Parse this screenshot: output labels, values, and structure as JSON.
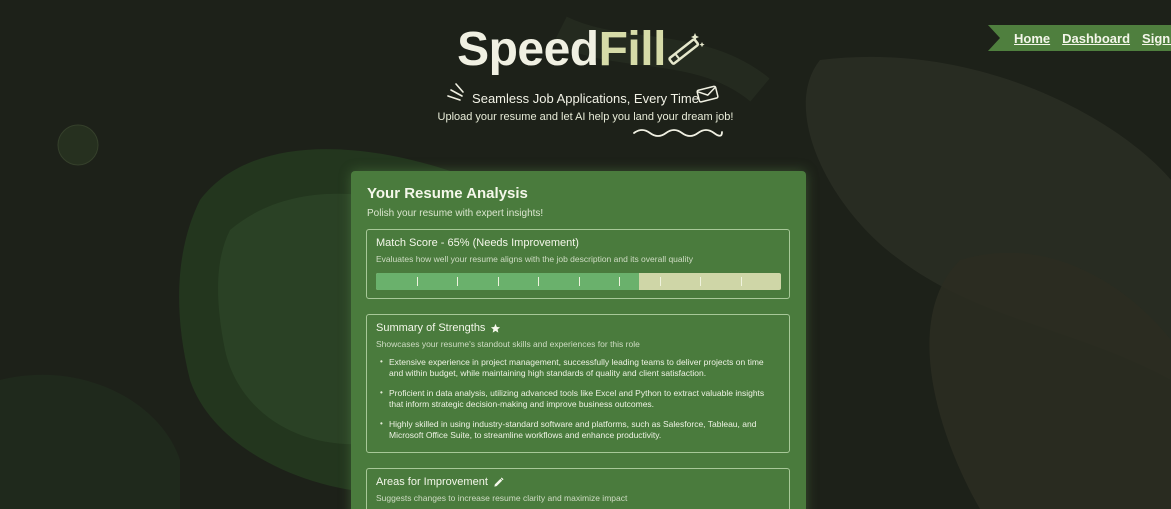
{
  "nav": {
    "home": "Home",
    "dashboard": "Dashboard",
    "signout": "Sign Out"
  },
  "header": {
    "logo_part1": "Speed",
    "logo_part2": "Fill",
    "tagline": "Seamless Job Applications, Every Time",
    "subline": "Upload your resume and let AI help you land your dream job!"
  },
  "card": {
    "title": "Your Resume Analysis",
    "subtitle": "Polish your resume with expert insights!",
    "match": {
      "title": "Match Score - 65% (Needs Improvement)",
      "description": "Evaluates how well your resume aligns with the job description and its overall quality",
      "score_percent": 65
    },
    "strengths": {
      "title": "Summary of Strengths",
      "icon": "star-icon",
      "description": "Showcases your resume's standout skills and experiences for this role",
      "items": [
        "Extensive experience in project management, successfully leading teams to deliver projects on time and within budget, while maintaining high standards of quality and client satisfaction.",
        "Proficient in data analysis, utilizing advanced tools like Excel and Python to extract valuable insights that inform strategic decision-making and improve business outcomes.",
        "Highly skilled in using industry-standard software and platforms, such as Salesforce, Tableau, and Microsoft Office Suite, to streamline workflows and enhance productivity."
      ]
    },
    "improvement": {
      "title": "Areas for Improvement",
      "icon": "pencil-icon",
      "description": "Suggests changes to increase resume clarity and maximize impact"
    }
  },
  "colors": {
    "background": "#1d2119",
    "card": "#4a7b3d",
    "progress_fill": "#6ab16c",
    "progress_track": "#cfd6a7",
    "nav": "#4f7f3e"
  }
}
